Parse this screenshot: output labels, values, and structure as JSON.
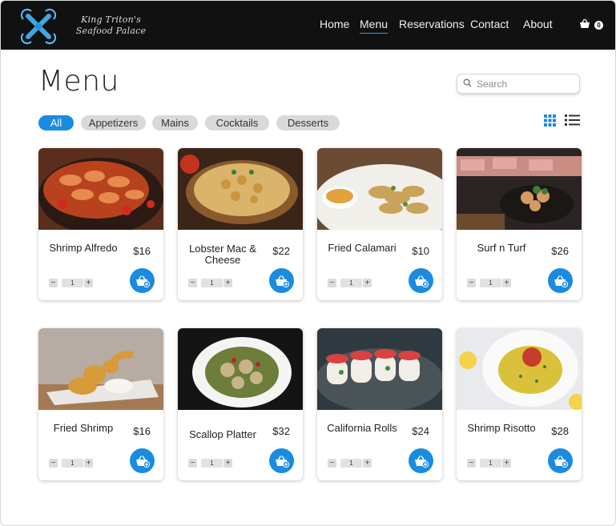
{
  "header": {
    "brand_line1": "King Triton's",
    "brand_line2": "Seafood Palace",
    "nav": [
      {
        "label": "Home"
      },
      {
        "label": "Menu",
        "active": true
      },
      {
        "label": "Reservations"
      },
      {
        "label": "Contact"
      },
      {
        "label": "About"
      }
    ],
    "cart_count": "0"
  },
  "page": {
    "title": "Menu",
    "search_placeholder": "Search"
  },
  "filters": [
    {
      "label": "All",
      "active": true
    },
    {
      "label": "Appetizers"
    },
    {
      "label": "Mains"
    },
    {
      "label": "Cocktails"
    },
    {
      "label": "Desserts"
    }
  ],
  "menu_items": [
    {
      "name": "Shrimp Alfredo",
      "price": "$16",
      "qty": "1"
    },
    {
      "name": "Lobster Mac & Cheese",
      "price": "$22",
      "qty": "1"
    },
    {
      "name": "Fried Calamari",
      "price": "$10",
      "qty": "1"
    },
    {
      "name": "Surf n Turf",
      "price": "$26",
      "qty": "1"
    },
    {
      "name": "Fried Shrimp",
      "price": "$16",
      "qty": "1"
    },
    {
      "name": "Scallop Platter",
      "price": "$32",
      "qty": "1"
    },
    {
      "name": "California Rolls",
      "price": "$24",
      "qty": "1"
    },
    {
      "name": "Shrimp Risotto",
      "price": "$28",
      "qty": "1"
    }
  ],
  "controls": {
    "minus": "−",
    "plus": "+"
  },
  "icons": {
    "logo": "trident-x-logo-icon",
    "cart": "shopping-basket-icon",
    "search": "search-icon",
    "grid": "grid-view-icon",
    "list": "list-view-icon",
    "add": "add-to-basket-icon"
  },
  "colors": {
    "accent": "#1a8be0",
    "header_bg": "#111111",
    "chip_bg": "#d9d9d9"
  }
}
